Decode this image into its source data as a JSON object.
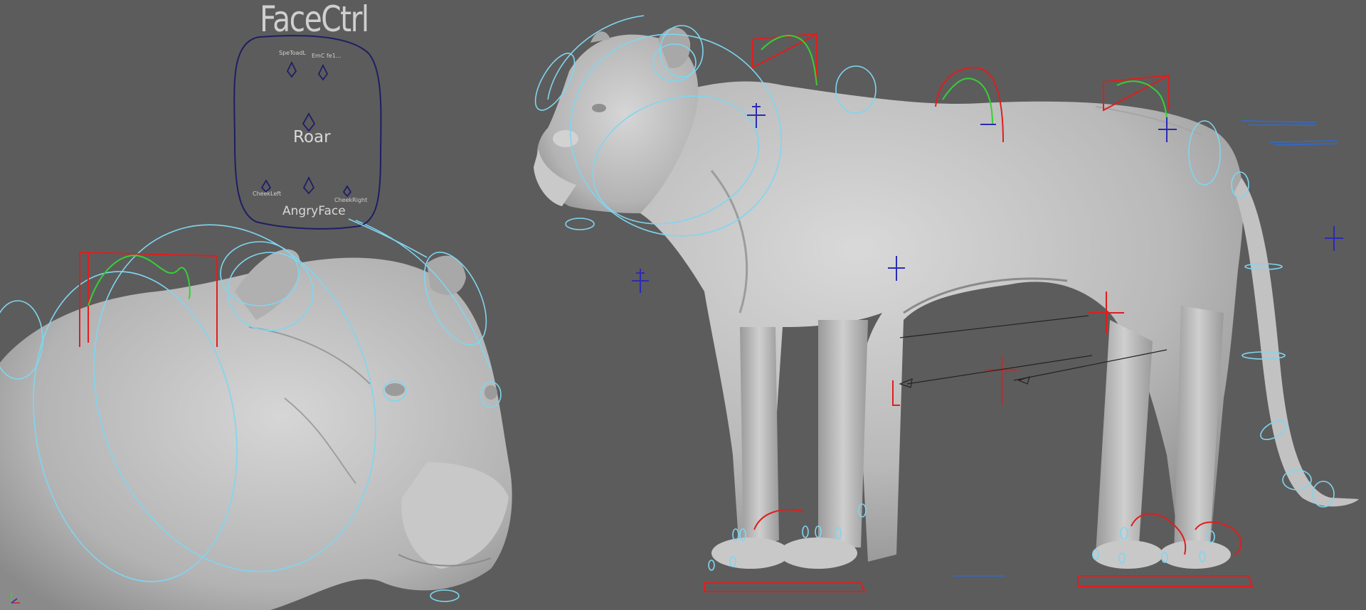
{
  "viewport": {
    "background": "#5c5c5c",
    "mesh_color": "#bdbdbd",
    "control_color_cyan": "#7fd6f0",
    "control_color_red": "#e11d1d",
    "control_color_green": "#34d134",
    "control_color_blue": "#2b2bb3"
  },
  "face_panel": {
    "title": "FaceCtrl",
    "top_left_label": "SpeToadL",
    "top_right_label": "EmC fe1...",
    "center_label": "Roar",
    "bottom_left_label": "CheekRight",
    "bottom_right_label": "CheekLeft",
    "bottom_label": "AngryFace"
  },
  "icons": {
    "axis_gizmo": "axis-gizmo-icon",
    "locator": "locator-cross-icon",
    "face_slider_handle": "diamond-handle-icon"
  }
}
